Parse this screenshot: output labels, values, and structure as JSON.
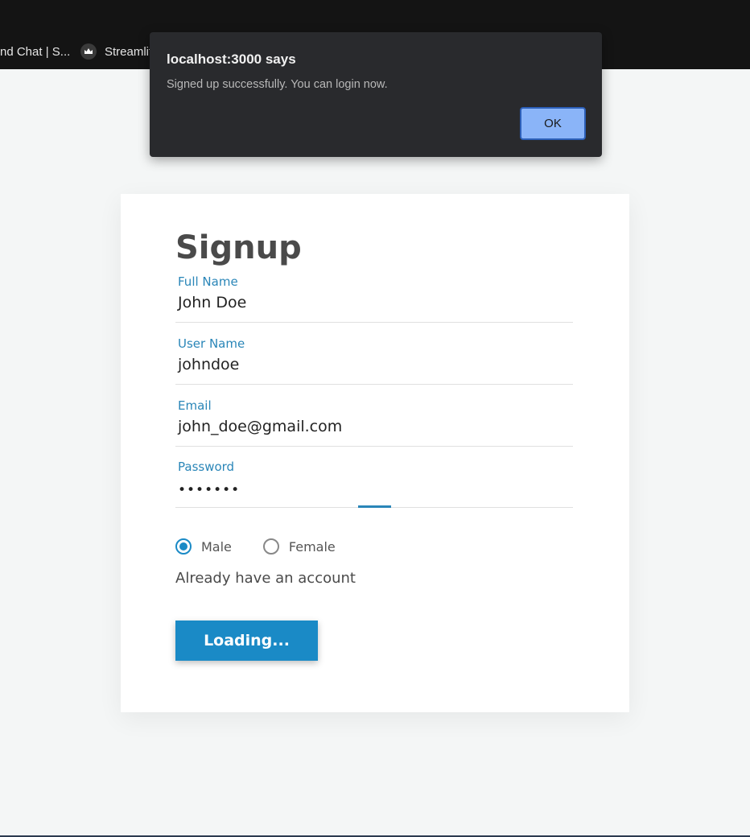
{
  "browser": {
    "bookmarks": [
      {
        "label": "nd Chat | S...",
        "icon": "none"
      },
      {
        "label": "Streamlit",
        "icon": "crown-icon"
      }
    ]
  },
  "alert": {
    "title": "localhost:3000 says",
    "message": "Signed up successfully. You can login now.",
    "ok_label": "OK"
  },
  "form": {
    "title": "Signup",
    "fields": [
      {
        "label": "Full Name",
        "value": "John Doe"
      },
      {
        "label": "User Name",
        "value": "johndoe"
      },
      {
        "label": "Email",
        "value": "john_doe@gmail.com"
      },
      {
        "label": "Password",
        "value": "•••••••"
      }
    ],
    "gender": {
      "options": [
        "Male",
        "Female"
      ],
      "selected": "Male"
    },
    "account_link": "Already have an account",
    "submit_label": "Loading..."
  },
  "colors": {
    "accent": "#1a8ac6",
    "dialog_bg": "#292a2d",
    "ok_button": "#8ab4f8"
  }
}
